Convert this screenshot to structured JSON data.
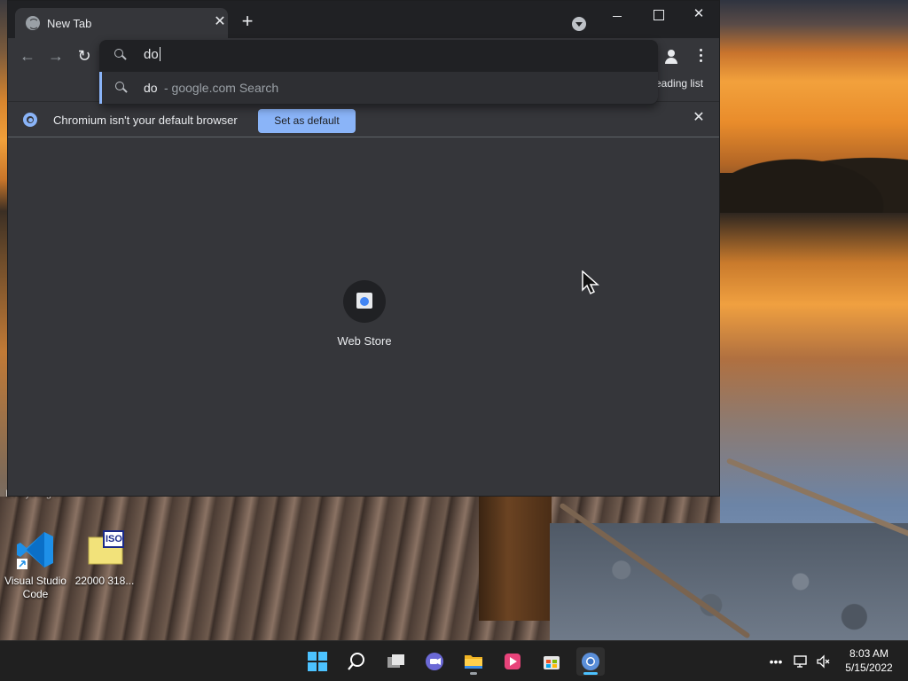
{
  "desktop": {
    "partial_label": "Everything  ...",
    "icons": [
      {
        "label": "Visual Studio Code"
      },
      {
        "label": "22000 318...",
        "badge": "ISO"
      }
    ]
  },
  "browser": {
    "tab": {
      "title": "New Tab"
    },
    "omnibox": {
      "typed": "do",
      "suggestion_main": "do",
      "suggestion_sub": "- google.com Search"
    },
    "bookmarks_bar": {
      "reading_list": "eading list"
    },
    "infobar": {
      "message": "Chromium isn't your default browser",
      "button": "Set as default"
    },
    "ntp": {
      "shortcuts": [
        {
          "label": "Web Store"
        }
      ]
    },
    "colors": {
      "accent": "#8ab4f8",
      "frame": "#202124",
      "surface": "#35363a"
    }
  },
  "taskbar": {
    "apps": [
      {
        "name": "start"
      },
      {
        "name": "search"
      },
      {
        "name": "task-view"
      },
      {
        "name": "teams-chat"
      },
      {
        "name": "file-explorer"
      },
      {
        "name": "media-player"
      },
      {
        "name": "microsoft-store"
      },
      {
        "name": "chromium"
      }
    ],
    "clock": {
      "time": "8:03 AM",
      "date": "5/15/2022"
    }
  }
}
